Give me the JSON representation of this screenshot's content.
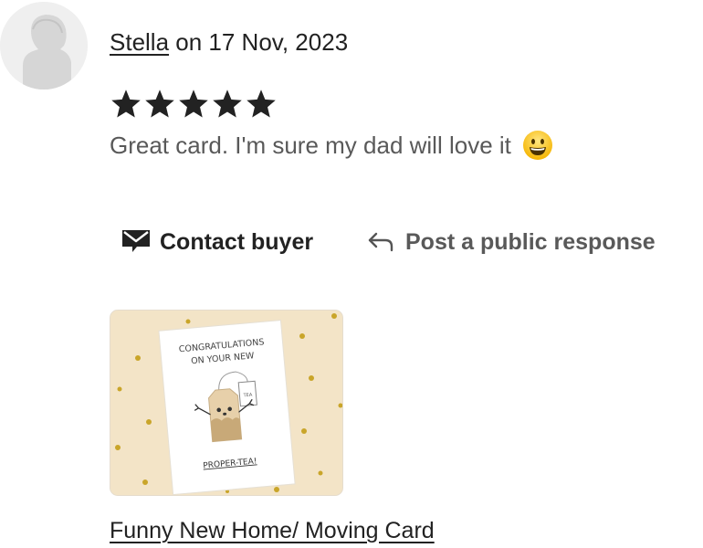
{
  "review": {
    "reviewer_name": "Stella",
    "date_text": " on 17 Nov, 2023",
    "rating": 5,
    "max_rating": 5,
    "text": "Great card. I'm sure my dad will love it",
    "emoji_icon": "grinning-face-emoji"
  },
  "actions": {
    "contact_label": "Contact buyer",
    "contact_icon": "envelope-icon",
    "post_label": "Post a public response",
    "post_icon": "reply-arrow-icon"
  },
  "product": {
    "link_text": "Funny New Home/ Moving Card",
    "card_text_line1": "CONGRATULATIONS",
    "card_text_line2": "ON YOUR NEW",
    "card_text_tag": "PROPER-TEA!",
    "card_tag_label": "TEA"
  },
  "colors": {
    "star": "#222222",
    "thumb_background": "#f3e4c7",
    "gold_dots": "#c9a52a"
  }
}
